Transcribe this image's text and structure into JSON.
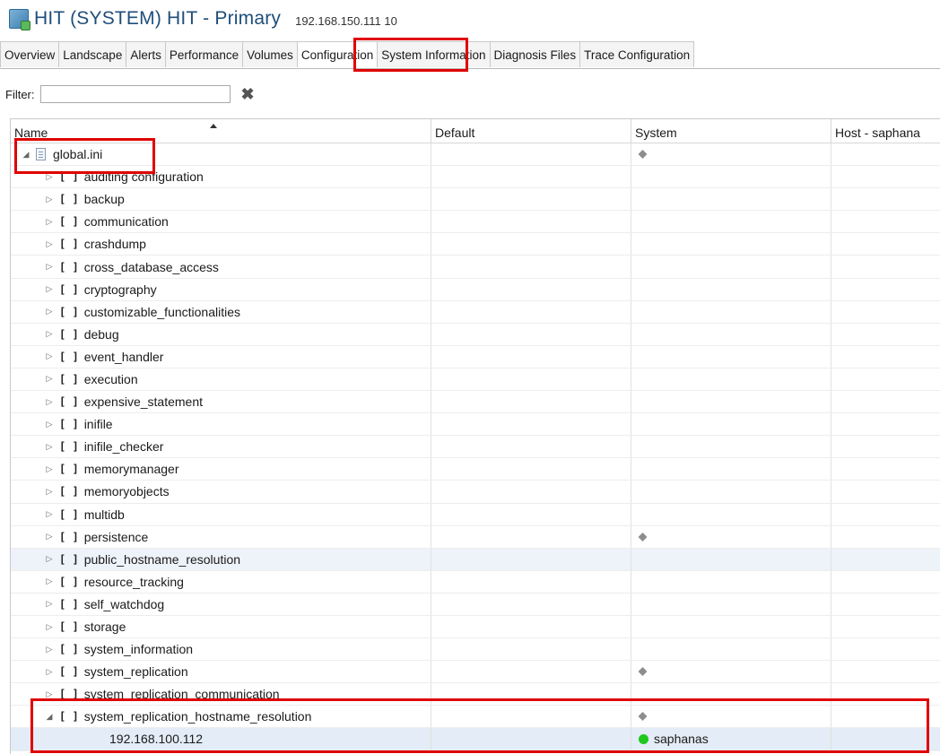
{
  "window": {
    "title": "HIT (SYSTEM) HIT - Primary",
    "host_info": "192.168.150.111 10"
  },
  "tabs": [
    {
      "label": "Overview"
    },
    {
      "label": "Landscape"
    },
    {
      "label": "Alerts"
    },
    {
      "label": "Performance"
    },
    {
      "label": "Volumes"
    },
    {
      "label": "Configuration"
    },
    {
      "label": "System Information"
    },
    {
      "label": "Diagnosis Files"
    },
    {
      "label": "Trace Configuration"
    }
  ],
  "active_tab": "Configuration",
  "filter": {
    "label": "Filter:",
    "value": "",
    "placeholder": ""
  },
  "table": {
    "columns": [
      {
        "label": "Name"
      },
      {
        "label": "Default"
      },
      {
        "label": "System"
      },
      {
        "label": "Host - saphana"
      }
    ],
    "sort_column": "Name",
    "rows": [
      {
        "kind": "file",
        "expanded": true,
        "name": "global.ini",
        "system_marker": true
      },
      {
        "kind": "section",
        "name": "auditing configuration"
      },
      {
        "kind": "section",
        "name": "backup"
      },
      {
        "kind": "section",
        "name": "communication"
      },
      {
        "kind": "section",
        "name": "crashdump"
      },
      {
        "kind": "section",
        "name": "cross_database_access"
      },
      {
        "kind": "section",
        "name": "cryptography"
      },
      {
        "kind": "section",
        "name": "customizable_functionalities"
      },
      {
        "kind": "section",
        "name": "debug"
      },
      {
        "kind": "section",
        "name": "event_handler"
      },
      {
        "kind": "section",
        "name": "execution"
      },
      {
        "kind": "section",
        "name": "expensive_statement"
      },
      {
        "kind": "section",
        "name": "inifile"
      },
      {
        "kind": "section",
        "name": "inifile_checker"
      },
      {
        "kind": "section",
        "name": "memorymanager"
      },
      {
        "kind": "section",
        "name": "memoryobjects"
      },
      {
        "kind": "section",
        "name": "multidb"
      },
      {
        "kind": "section",
        "name": "persistence",
        "system_marker": true
      },
      {
        "kind": "section",
        "name": "public_hostname_resolution",
        "alt": true
      },
      {
        "kind": "section",
        "name": "resource_tracking"
      },
      {
        "kind": "section",
        "name": "self_watchdog"
      },
      {
        "kind": "section",
        "name": "storage"
      },
      {
        "kind": "section",
        "name": "system_information"
      },
      {
        "kind": "section",
        "name": "system_replication",
        "system_marker": true
      },
      {
        "kind": "section",
        "name": "system_replication_communication"
      },
      {
        "kind": "section",
        "expanded": true,
        "name": "system_replication_hostname_resolution",
        "system_marker": true
      },
      {
        "kind": "param",
        "name": "192.168.100.112",
        "system_value": "saphanas",
        "status_color": "#1fc81f",
        "selected": true
      }
    ]
  },
  "colors": {
    "highlight": "#e00000",
    "title": "#1f4e7a",
    "status_ok": "#1fc81f"
  },
  "icons": {
    "app": "hana-system-icon",
    "clear": "clear-filter-icon",
    "file": "ini-file-icon",
    "marker": "diamond-icon",
    "status": "green-dot-icon",
    "expand": "expand-triangle-icon",
    "collapse": "collapse-triangle-icon"
  }
}
